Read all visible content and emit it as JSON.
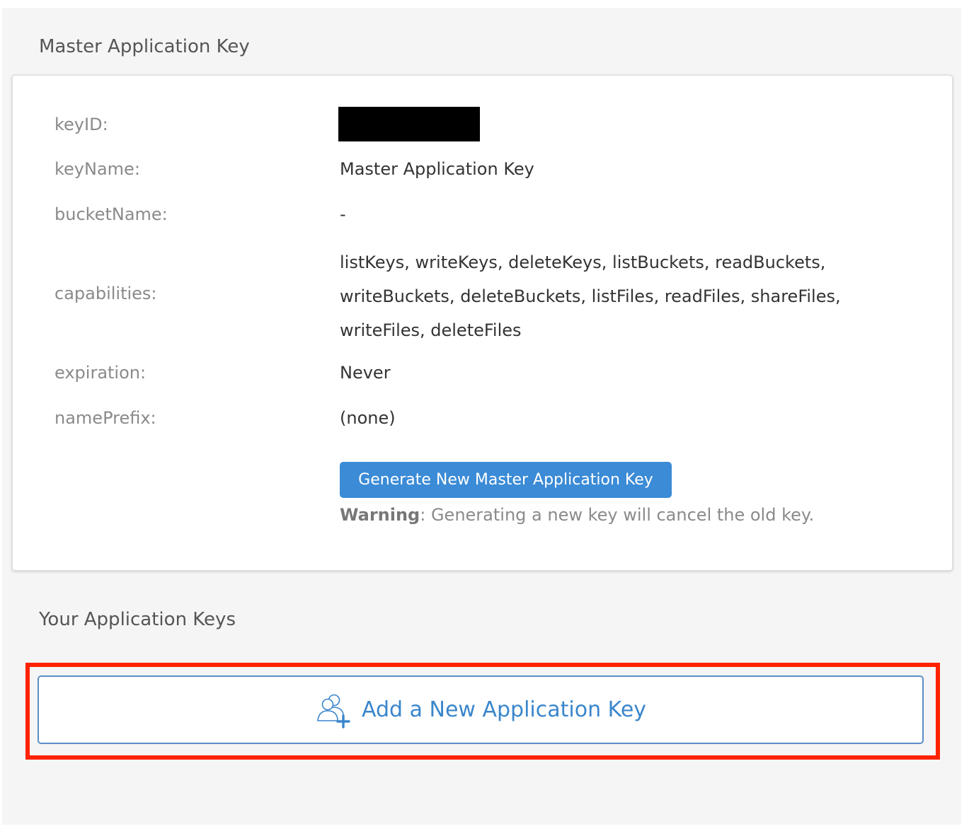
{
  "master": {
    "section_title": "Master Application Key",
    "rows": {
      "keyID": {
        "label": "keyID:"
      },
      "keyName": {
        "label": "keyName:",
        "value": "Master Application Key"
      },
      "bucketName": {
        "label": "bucketName:",
        "value": "-"
      },
      "capabilities": {
        "label": "capabilities:",
        "value": "listKeys, writeKeys, deleteKeys, listBuckets, readBuckets, writeBuckets, deleteBuckets, listFiles, readFiles, shareFiles, writeFiles, deleteFiles"
      },
      "expiration": {
        "label": "expiration:",
        "value": "Never"
      },
      "namePrefix": {
        "label": "namePrefix:",
        "value": "(none)"
      }
    },
    "generate_button_label": "Generate New Master Application Key",
    "warning_bold": "Warning",
    "warning_text": ": Generating a new key will cancel the old key."
  },
  "your_keys": {
    "section_title": "Your Application Keys",
    "add_button_label": "Add a New Application Key",
    "add_button_icon": "users-add-icon"
  },
  "colors": {
    "accent": "#3b8bd6",
    "link": "#3a86cc",
    "highlight": "#ff2200",
    "page_bg": "#f5f5f5"
  }
}
